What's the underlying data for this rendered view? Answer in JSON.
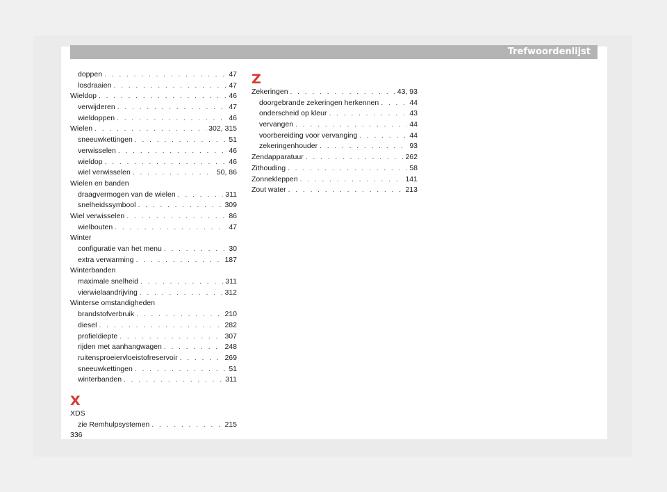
{
  "header": {
    "title": "Trefwoordenlijst"
  },
  "left_column": [
    {
      "kind": "entry",
      "term": "doppen",
      "page": "47",
      "sub": true
    },
    {
      "kind": "entry",
      "term": "losdraaien",
      "page": "47",
      "sub": true
    },
    {
      "kind": "entry",
      "term": "Wieldop",
      "page": "46",
      "sub": false
    },
    {
      "kind": "entry",
      "term": "verwijderen",
      "page": "47",
      "sub": true
    },
    {
      "kind": "entry",
      "term": "wieldoppen",
      "page": "46",
      "sub": true
    },
    {
      "kind": "entry",
      "term": "Wielen",
      "page": "302, 315",
      "sub": false
    },
    {
      "kind": "entry",
      "term": "sneeuwkettingen",
      "page": "51",
      "sub": true
    },
    {
      "kind": "entry",
      "term": "verwisselen",
      "page": "46",
      "sub": true
    },
    {
      "kind": "entry",
      "term": "wieldop",
      "page": "46",
      "sub": true
    },
    {
      "kind": "entry",
      "term": "wiel verwisselen",
      "page": "50, 86",
      "sub": true
    },
    {
      "kind": "head",
      "term": "Wielen en banden"
    },
    {
      "kind": "entry",
      "term": "draagvermogen van de wielen",
      "page": "311",
      "sub": true
    },
    {
      "kind": "entry",
      "term": "snelheidssymbool",
      "page": "309",
      "sub": true
    },
    {
      "kind": "entry",
      "term": "Wiel verwisselen",
      "page": "86",
      "sub": false
    },
    {
      "kind": "entry",
      "term": "wielbouten",
      "page": "47",
      "sub": true
    },
    {
      "kind": "head",
      "term": "Winter"
    },
    {
      "kind": "entry",
      "term": "configuratie van het menu",
      "page": "30",
      "sub": true
    },
    {
      "kind": "entry",
      "term": "extra verwarming",
      "page": "187",
      "sub": true
    },
    {
      "kind": "head",
      "term": "Winterbanden"
    },
    {
      "kind": "entry",
      "term": "maximale snelheid",
      "page": "311",
      "sub": true
    },
    {
      "kind": "entry",
      "term": "vierwielaandrijving",
      "page": "312",
      "sub": true
    },
    {
      "kind": "head",
      "term": "Winterse omstandigheden"
    },
    {
      "kind": "entry",
      "term": "brandstofverbruik",
      "page": "210",
      "sub": true
    },
    {
      "kind": "entry",
      "term": "diesel",
      "page": "282",
      "sub": true
    },
    {
      "kind": "entry",
      "term": "profieldiepte",
      "page": "307",
      "sub": true
    },
    {
      "kind": "entry",
      "term": "rijden met aanhangwagen",
      "page": "248",
      "sub": true
    },
    {
      "kind": "entry",
      "term": "ruitensproeiervloeistofreservoir",
      "page": "269",
      "sub": true
    },
    {
      "kind": "entry",
      "term": "sneeuwkettingen",
      "page": "51",
      "sub": true
    },
    {
      "kind": "entry",
      "term": "winterbanden",
      "page": "311",
      "sub": true
    },
    {
      "kind": "gap"
    },
    {
      "kind": "letter",
      "term": "X"
    },
    {
      "kind": "head",
      "term": "XDS"
    },
    {
      "kind": "entry",
      "term": "zie Remhulpsystemen",
      "page": "215",
      "sub": true
    }
  ],
  "right_column": [
    {
      "kind": "letter",
      "term": "Z"
    },
    {
      "kind": "entry",
      "term": "Zekeringen",
      "page": "43, 93",
      "sub": false
    },
    {
      "kind": "entry",
      "term": "doorgebrande zekeringen herkennen",
      "page": "44",
      "sub": true
    },
    {
      "kind": "entry",
      "term": "onderscheid op kleur",
      "page": "43",
      "sub": true
    },
    {
      "kind": "entry",
      "term": "vervangen",
      "page": "44",
      "sub": true
    },
    {
      "kind": "entry",
      "term": "voorbereiding voor vervanging",
      "page": "44",
      "sub": true
    },
    {
      "kind": "entry",
      "term": "zekeringenhouder",
      "page": "93",
      "sub": true
    },
    {
      "kind": "entry",
      "term": "Zendapparatuur",
      "page": "262",
      "sub": false
    },
    {
      "kind": "entry",
      "term": "Zithouding",
      "page": "58",
      "sub": false
    },
    {
      "kind": "entry",
      "term": "Zonnekleppen",
      "page": "141",
      "sub": false
    },
    {
      "kind": "entry",
      "term": "Zout water",
      "page": "213",
      "sub": false
    }
  ],
  "footer": {
    "page_number": "336"
  },
  "colors": {
    "letter": "#d63a33",
    "header_bar": "#b4b4b4"
  }
}
